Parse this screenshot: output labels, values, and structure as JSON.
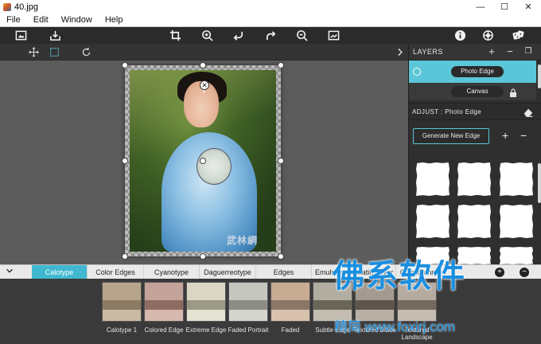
{
  "window": {
    "title": "40.jpg",
    "minimize": "—",
    "maximize": "☐",
    "close": "✕"
  },
  "menu": [
    "File",
    "Edit",
    "Window",
    "Help"
  ],
  "toolbar": {
    "left": [
      "image-frame-icon",
      "import-icon"
    ],
    "center": [
      "crop-icon",
      "zoom-in-icon",
      "rotate-left-icon",
      "rotate-right-icon",
      "zoom-out-icon",
      "fit-image-icon"
    ],
    "right": [
      "info-icon",
      "settings-icon",
      "dice-icon"
    ]
  },
  "canvas": {
    "photo_watermark": "武林網"
  },
  "layers_panel": {
    "title": "LAYERS",
    "add": "+",
    "remove": "−",
    "layers": [
      {
        "name": "Photo Edge",
        "active": true
      },
      {
        "name": "Canvas",
        "active": false,
        "locked": true
      }
    ]
  },
  "adjust_panel": {
    "title": "ADJUST : Photo Edge",
    "generate_button": "Generate New Edge",
    "add": "+",
    "remove": "−"
  },
  "filter_tabs": {
    "tabs": [
      "Calotype",
      "Color Edges",
      "Cyanotype",
      "Daguerreotype",
      "Edges",
      "Emulsion",
      "Gelatin Silver",
      "Gum Bichro"
    ],
    "active": "Calotype",
    "add": "+",
    "remove": "−"
  },
  "presets": [
    {
      "label": "Calotype 1",
      "colors": [
        "#b7a48c",
        "#8d7a63",
        "#c9b9a2"
      ]
    },
    {
      "label": "Colored Edge",
      "colors": [
        "#c4a39a",
        "#8f6c61",
        "#d7b8ae"
      ]
    },
    {
      "label": "Extreme Edge",
      "colors": [
        "#dcd7c4",
        "#9b9a86",
        "#e4e2d2"
      ]
    },
    {
      "label": "Faded Portrait",
      "colors": [
        "#c6c6c0",
        "#8d8d86",
        "#d6d6d0"
      ]
    },
    {
      "label": "Faded",
      "colors": [
        "#c8ab93",
        "#8c7766",
        "#d8c1ad"
      ]
    },
    {
      "label": "Subtle Edge",
      "colors": [
        "#b1ada0",
        "#6a6657",
        "#c2bdb0"
      ]
    },
    {
      "label": "Textured Black",
      "colors": [
        "#a49a90",
        "#5e554c",
        "#b8afa5"
      ]
    },
    {
      "label": "Textured Landscape",
      "colors": [
        "#b6aba1",
        "#766a60",
        "#c6bcb2"
      ]
    }
  ],
  "overlay_watermark": {
    "brand": "佛系软件",
    "url": "精简 www.foxirj.com"
  }
}
